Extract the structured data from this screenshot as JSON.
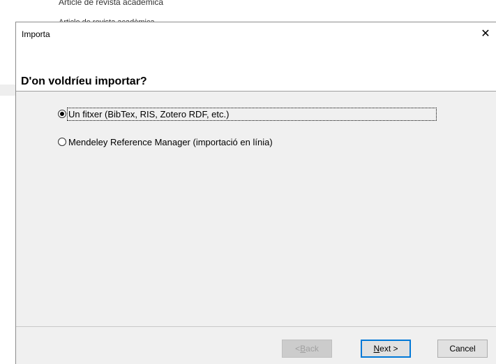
{
  "background": {
    "line1": "Article de revista acadèmica",
    "line2": "Article de revista acadèmica"
  },
  "dialog": {
    "title": "Importa",
    "close_glyph": "✕",
    "heading": "D'on voldríeu importar?",
    "options": [
      {
        "label": "Un fitxer (BibTex, RIS, Zotero RDF, etc.)",
        "selected": true
      },
      {
        "label": "Mendeley Reference Manager (importació en línia)",
        "selected": false
      }
    ],
    "buttons": {
      "back_prefix": "< ",
      "back_mnemonic": "B",
      "back_rest": "ack",
      "next_mnemonic": "N",
      "next_rest": "ext >",
      "cancel": "Cancel"
    }
  }
}
